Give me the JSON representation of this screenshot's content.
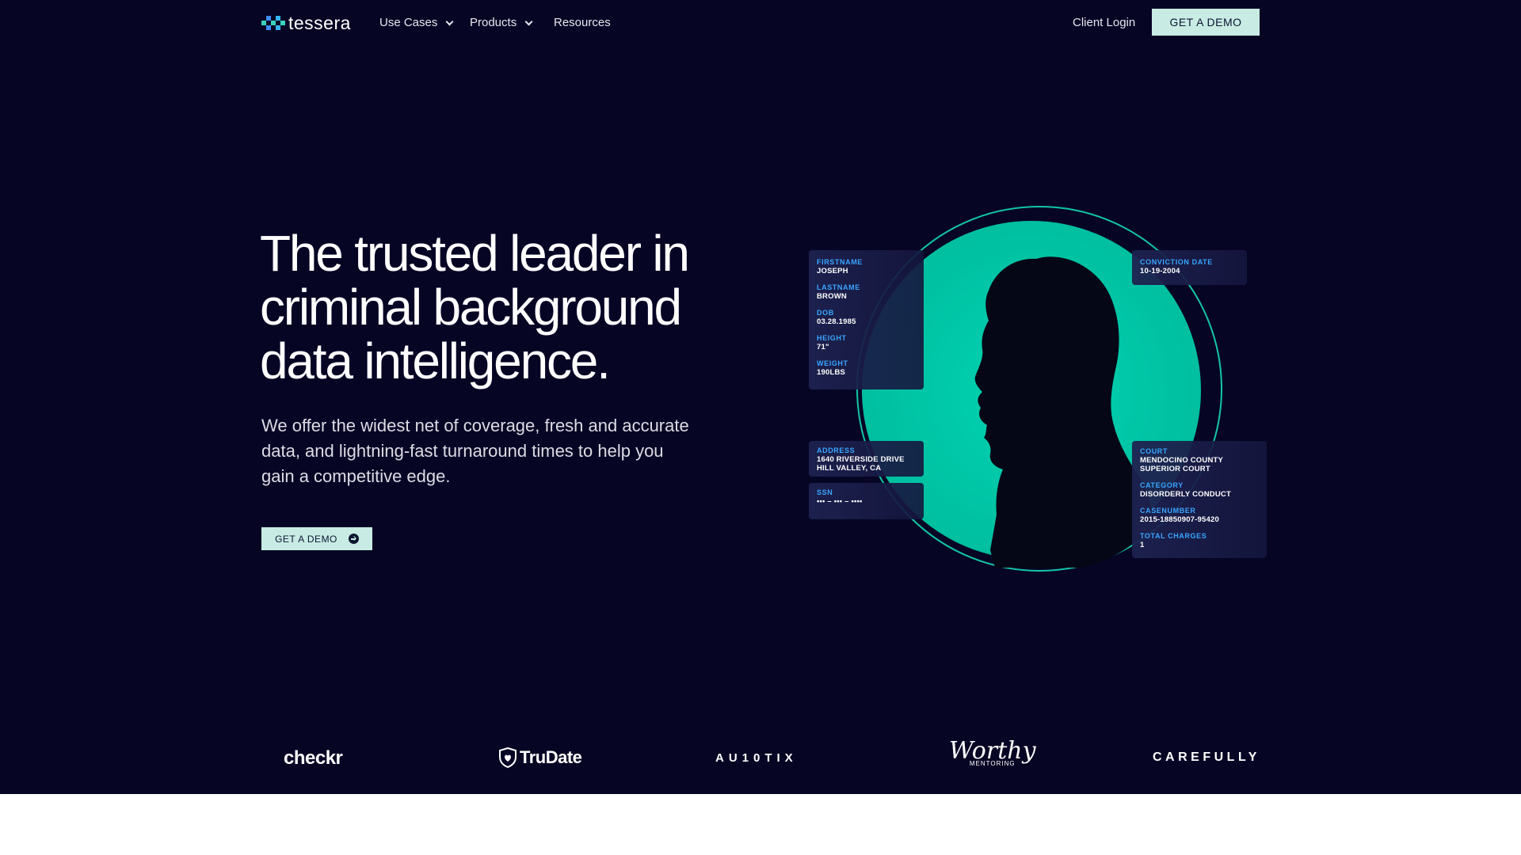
{
  "nav": {
    "brand": "tessera",
    "items": [
      {
        "label": "Use Cases",
        "has_dropdown": true
      },
      {
        "label": "Products",
        "has_dropdown": true
      },
      {
        "label": "Resources",
        "has_dropdown": false
      }
    ],
    "client_login": "Client Login",
    "cta": "GET A DEMO"
  },
  "hero": {
    "headline_lines": [
      "The trusted leader in",
      "criminal background",
      "data intelligence."
    ],
    "subcopy_lines": [
      "We offer the widest net of coverage, fresh and accurate",
      "data, and lightning-fast turnaround times to help you",
      "gain a competitive edge."
    ],
    "cta": "GET A DEMO",
    "cta_icon": "arrow-right-circle-icon"
  },
  "profile": {
    "identity": [
      {
        "key": "FIRSTNAME",
        "value": "JOSEPH"
      },
      {
        "key": "LASTNAME",
        "value": "BROWN"
      },
      {
        "key": "DOB",
        "value": "03.28.1985"
      },
      {
        "key": "HEIGHT",
        "value": "71\""
      },
      {
        "key": "WEIGHT",
        "value": "190LBS"
      }
    ],
    "conviction": {
      "key": "CONVICTION DATE",
      "value": "10-19-2004"
    },
    "address": {
      "key": "ADDRESS",
      "value_lines": [
        "1640 RIVERSIDE DRIVE",
        "HILL VALLEY, CA"
      ]
    },
    "ssn": {
      "key": "SSN",
      "value": "••• – ••• – ••••"
    },
    "court": [
      {
        "key": "COURT",
        "value_lines": [
          "MENDOCINO COUNTY",
          "SUPERIOR COURT"
        ]
      },
      {
        "key": "CATEGORY",
        "value_lines": [
          "DISORDERLY CONDUCT"
        ]
      },
      {
        "key": "CASENUMBER",
        "value_lines": [
          "2015-18850907-95420"
        ]
      },
      {
        "key": "TOTAL CHARGES",
        "value_lines": [
          "1"
        ]
      }
    ]
  },
  "logos": [
    "checkr",
    "TruDate",
    "AU10TIX",
    "Worthy",
    "MENTORING",
    "CAREFULLY"
  ],
  "colors": {
    "background": "#070524",
    "accent_teal": "#00c4a4",
    "cta_bg": "#c8ece4",
    "label_blue": "#39a6ff"
  }
}
